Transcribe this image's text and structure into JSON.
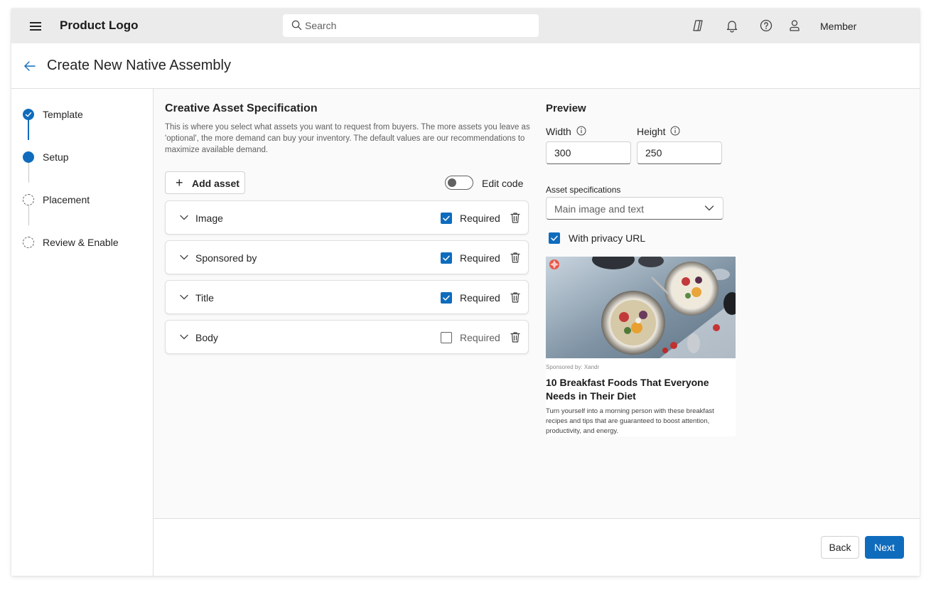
{
  "topbar": {
    "logo": "Product Logo",
    "search_placeholder": "Search",
    "icons": [
      "copilot-icon",
      "bell-icon",
      "help-icon",
      "person-icon"
    ],
    "user_label": "Member"
  },
  "header": {
    "title": "Create New Native Assembly"
  },
  "stepper": {
    "steps": [
      {
        "label": "Template",
        "state": "completed"
      },
      {
        "label": "Setup",
        "state": "current"
      },
      {
        "label": "Placement",
        "state": "pending"
      },
      {
        "label": "Review & Enable",
        "state": "pending"
      }
    ]
  },
  "spec": {
    "title": "Creative Asset Specification",
    "description": "This is where you select what assets you want to request from buyers. The more assets you leave as 'optional', the more demand can buy your inventory. The default values are our recommendations to maximize available demand.",
    "add_asset_label": "Add asset",
    "edit_code_label": "Edit code",
    "edit_code_on": false,
    "assets": [
      {
        "name": "Image",
        "required": true,
        "required_label": "Required"
      },
      {
        "name": "Sponsored by",
        "required": true,
        "required_label": "Required"
      },
      {
        "name": "Title",
        "required": true,
        "required_label": "Required"
      },
      {
        "name": "Body",
        "required": false,
        "required_label": "Required"
      }
    ]
  },
  "preview": {
    "title": "Preview",
    "width_label": "Width",
    "width_value": "300",
    "height_label": "Height",
    "height_value": "250",
    "asset_spec_label": "Asset specifications",
    "asset_spec_value": "Main image and text",
    "privacy_label": "With privacy URL",
    "privacy_checked": true,
    "ad": {
      "sponsor": "Sponsored by: Xandr",
      "title": "10 Breakfast Foods That Everyone Needs in Their Diet",
      "body": "Turn yourself into a morning person with these breakfast recipes and tips that are guaranteed to boost attention, productivity, and energy."
    }
  },
  "footer": {
    "back_label": "Back",
    "next_label": "Next"
  },
  "colors": {
    "accent": "#0f6cbd",
    "topbar_bg": "#ebebeb",
    "main_bg": "#fafafa"
  }
}
